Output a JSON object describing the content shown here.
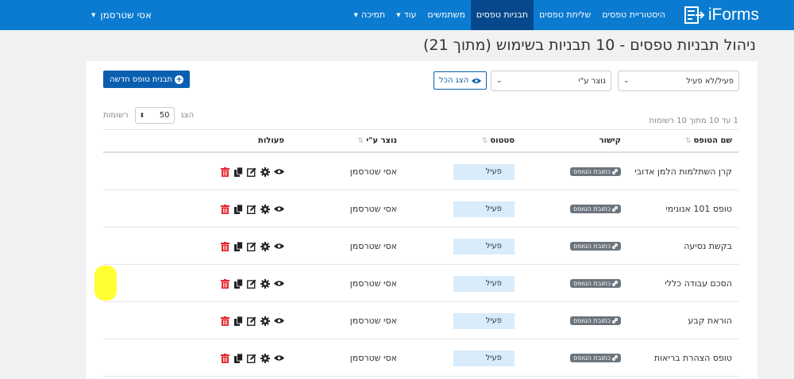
{
  "nav": {
    "user": "אסי שטרסמן",
    "brand": "iForms",
    "items": [
      {
        "label": "היסטוריית טפסים",
        "dropdown": false,
        "active": false
      },
      {
        "label": "שליחת טפסים",
        "dropdown": false,
        "active": false
      },
      {
        "label": "תבניות טפסים",
        "dropdown": false,
        "active": true
      },
      {
        "label": "משתמשים",
        "dropdown": false,
        "active": false
      },
      {
        "label": "עוד",
        "dropdown": true,
        "active": false
      },
      {
        "label": "תמיכה",
        "dropdown": true,
        "active": false
      }
    ]
  },
  "page": {
    "title": "ניהול תבניות טפסים - 10 תבניות בשימוש (מתוך 21)"
  },
  "toolbar": {
    "new_template": "תבנית טופס חדשה",
    "show_all": "הצג הכל",
    "creator_filter": "נוצר ע\"י",
    "status_filter": "פעיל/לא פעיל"
  },
  "pagination": {
    "show_label": "הצג",
    "page_size": "50",
    "records_label": "רשומות",
    "info": "1 עד 10 מתוך 10 רשומות"
  },
  "table": {
    "headers": {
      "name": "שם הטופס",
      "link": "קישור",
      "status": "סטטוס",
      "creator": "נוצר ע\"י",
      "actions": "פעולות"
    },
    "link_label": "כתובת הטופס",
    "rows": [
      {
        "name": "קרן השתלמות הלמן אדובי",
        "status": "פעיל",
        "creator": "אסי שטרסמן"
      },
      {
        "name": "טופס 101 אנונימי",
        "status": "פעיל",
        "creator": "אסי שטרסמן"
      },
      {
        "name": "בקשת נסיעה",
        "status": "פעיל",
        "creator": "אסי שטרסמן"
      },
      {
        "name": "הסכם עבודה כללי",
        "status": "פעיל",
        "creator": "אסי שטרסמן"
      },
      {
        "name": "הוראת קבע",
        "status": "פעיל",
        "creator": "אסי שטרסמן"
      },
      {
        "name": "טופס הצהרת בריאות",
        "status": "פעיל",
        "creator": "אסי שטרסמן"
      }
    ]
  },
  "colors": {
    "navbar": "#0a7bd0",
    "nav_active": "#07488c",
    "primary": "#0a5fb0",
    "delete": "#e3262d",
    "status_bg": "#d9ecfb",
    "link_badge": "#6c757d",
    "highlight": "#ffff33"
  }
}
